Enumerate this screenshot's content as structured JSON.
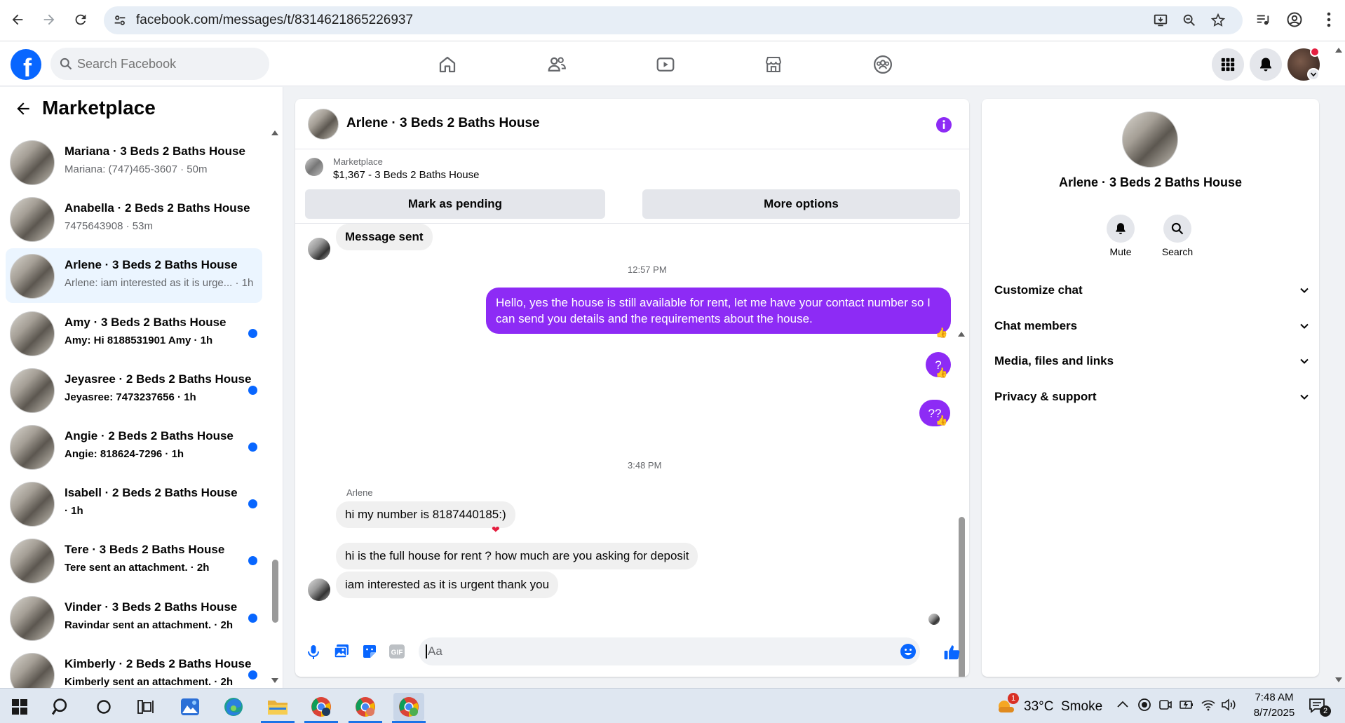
{
  "browser": {
    "url": "facebook.com/messages/t/8314621865226937",
    "icons": [
      "back-arrow-icon",
      "forward-arrow-icon",
      "reload-icon",
      "site-settings-icon",
      "install-icon",
      "zoom-icon",
      "star-icon",
      "media-icon",
      "profile-icon",
      "menu-icon"
    ]
  },
  "fb": {
    "logo": "f",
    "search_placeholder": "Search Facebook",
    "accent": "#0866ff"
  },
  "left": {
    "title": "Marketplace",
    "conversations": [
      {
        "title": "Mariana · 3 Beds 2 Baths House",
        "snippet": "Mariana: (747)465-3607 · 50m",
        "unread": false,
        "active": false
      },
      {
        "title": "Anabella · 2 Beds 2 Baths House",
        "snippet": "7475643908 · 53m",
        "unread": false,
        "active": false
      },
      {
        "title": "Arlene · 3 Beds 2 Baths House",
        "snippet": "Arlene: iam interested as it is urge... · 1h",
        "unread": false,
        "active": true
      },
      {
        "title": "Amy · 3 Beds 2 Baths House",
        "snippet": "Amy: Hi 8188531901 Amy · 1h",
        "unread": true,
        "active": false
      },
      {
        "title": "Jeyasree · 2 Beds 2 Baths House",
        "snippet": "Jeyasree: 7473237656 · 1h",
        "unread": true,
        "active": false
      },
      {
        "title": "Angie · 2 Beds 2 Baths House",
        "snippet": "Angie: 818624-7296 · 1h",
        "unread": true,
        "active": false
      },
      {
        "title": "Isabell · 2 Beds 2 Baths House",
        "snippet": " · 1h",
        "unread": true,
        "active": false
      },
      {
        "title": "Tere · 3 Beds 2 Baths House",
        "snippet": "Tere sent an attachment. · 2h",
        "unread": true,
        "active": false
      },
      {
        "title": "Vinder · 3 Beds 2 Baths House",
        "snippet": "Ravindar sent an attachment. · 2h",
        "unread": true,
        "active": false
      },
      {
        "title": "Kimberly · 2 Beds 2 Baths House",
        "snippet": "Kimberly sent an attachment. · 2h",
        "unread": true,
        "active": false
      }
    ]
  },
  "chat": {
    "title": "Arlene · 3 Beds 2 Baths House",
    "listing_label": "Marketplace",
    "listing_text": "$1,367 - 3 Beds 2 Baths House",
    "mark_pending": "Mark as pending",
    "more_options": "More options",
    "message_sent": "Message sent",
    "ts1": "12:57 PM",
    "out1": "Hello, yes the house is still available for rent, let me have your contact number so I can send you details and the requirements about the house.",
    "out2": "?",
    "out3": "??",
    "ts2": "3:48 PM",
    "sender": "Arlene",
    "in1": "hi my number is 8187440185:)",
    "in2": "hi is the full house for rent ? how much are you asking for deposit",
    "in3": "iam interested as it is urgent thank you",
    "input_placeholder": "Aa",
    "out_color": "#8d2bf5"
  },
  "right": {
    "title": "Arlene · 3 Beds 2 Baths House",
    "mute": "Mute",
    "search": "Search",
    "sections": [
      "Customize chat",
      "Chat members",
      "Media, files and links",
      "Privacy & support"
    ]
  },
  "taskbar": {
    "weather_badge": "1",
    "weather": "33°C  Smoke",
    "time": "7:48 AM",
    "date": "8/7/2025",
    "notif_count": "2"
  }
}
